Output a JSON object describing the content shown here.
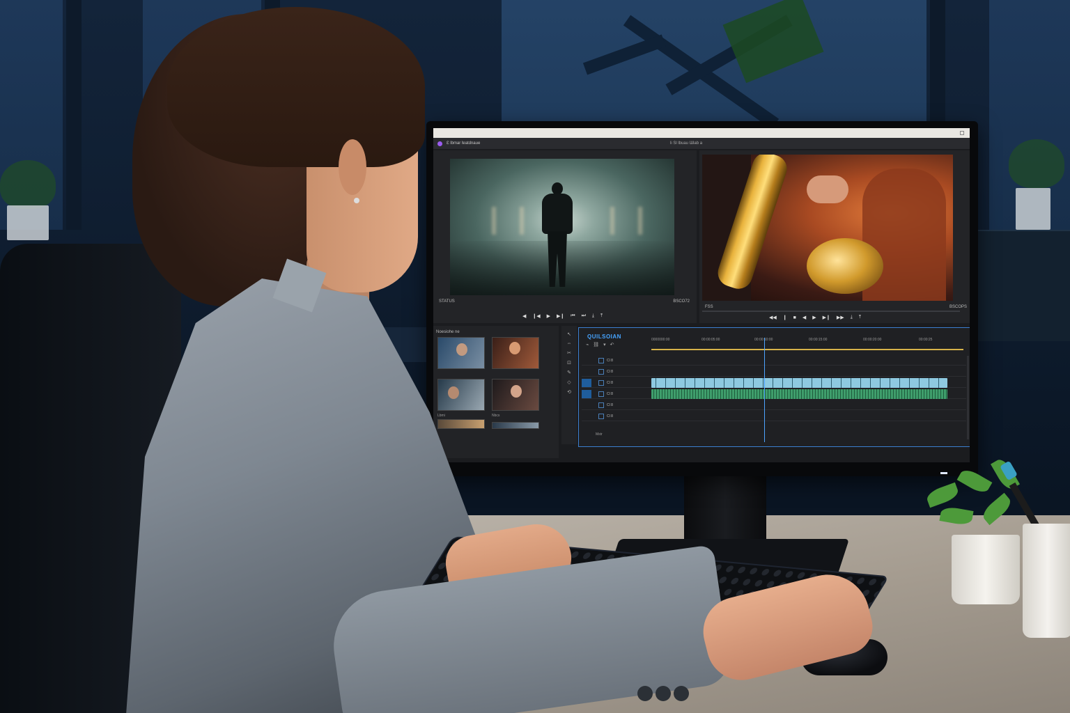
{
  "os_bar": {
    "title_left": "",
    "title_center": ""
  },
  "app": {
    "project_title": "Ɛ lbmar lɐatdnaue",
    "center_title": "li Sl lbuau Ɯlab a"
  },
  "source_monitor": {
    "timecode_left": "STATUS",
    "timecode_right": "BSCO72",
    "transport": [
      "◀",
      "❙◀",
      "▶",
      "▶❙",
      "⏮",
      "⏭",
      "⤓",
      "⤒"
    ]
  },
  "program_monitor": {
    "timecode_left": "FSS",
    "timecode_right": "BSCOPS",
    "transport": [
      "◀◀",
      "❙",
      "■",
      "◀",
      "▶",
      "▶❙",
      "▶▶",
      "⤓",
      "⤒"
    ]
  },
  "project_bin": {
    "title": "Noesiohe ne",
    "thumb_labels": [
      "",
      "",
      "Lbmi",
      "Nbcs"
    ]
  },
  "tools": [
    "↖",
    "⇔",
    "✂",
    "⊡",
    "✎",
    "◇",
    "⟲"
  ],
  "timeline": {
    "sequence_name": "QUILSOIAN",
    "ruler_labels": [
      "0000000:00",
      "00:00:05:00",
      "00:00:10:00",
      "00:00:15:00",
      "00:00:20:00",
      "00:00:25"
    ],
    "tracks": [
      {
        "name": "Cl 8",
        "kind": "empty"
      },
      {
        "name": "Cl 8",
        "kind": "empty"
      },
      {
        "name": "Cl 8",
        "kind": "video"
      },
      {
        "name": "Cl 8",
        "kind": "audio"
      },
      {
        "name": "Cl 8",
        "kind": "empty"
      },
      {
        "name": "Cl 8",
        "kind": "empty"
      }
    ],
    "master_label": "Mstr"
  }
}
